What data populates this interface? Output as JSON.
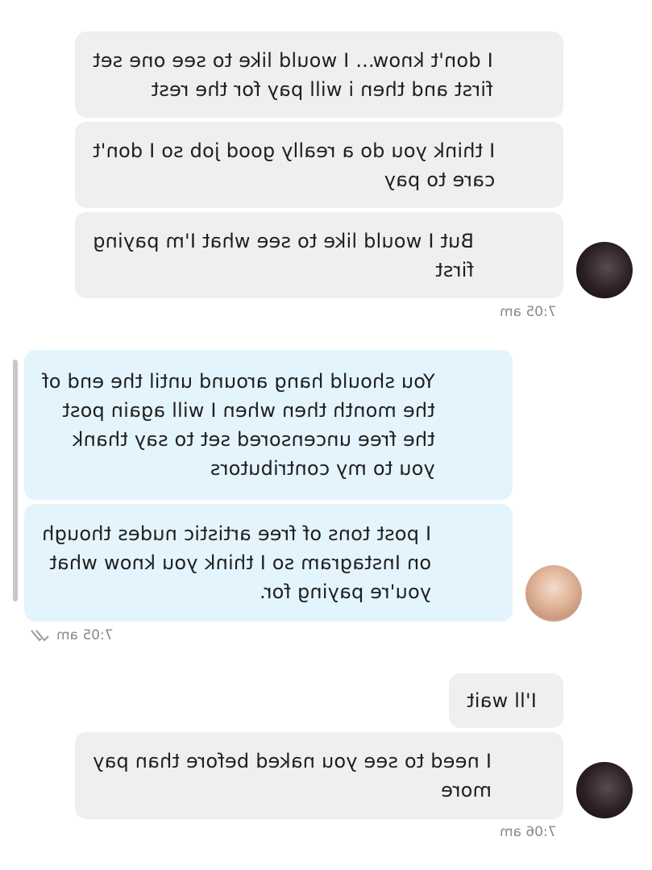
{
  "messages": [
    {
      "text": "I don't know... I would like to see one set\nfirst and then i will pay for the rest"
    },
    {
      "text": "I think you do a really good job so I don't\ncare to pay"
    },
    {
      "text": "But I would like to see what I'm paying\nfirst"
    },
    {
      "text": "You should hang around until the end of\nthe month then when I will again post\nthe free uncensored set to say thank\nyou to my contributors"
    },
    {
      "text": "I post tons of free artistic nudes though\non Instagram so I think you know what\nyou're paying for."
    },
    {
      "text": "I'll wait"
    },
    {
      "text": "I need to see you naked before than pay\nmore"
    }
  ],
  "timestamps": {
    "group1": "7:05 am",
    "group2": "7:05 am",
    "group3": "7:06 am"
  },
  "icons": {
    "read": "double-check-icon"
  }
}
